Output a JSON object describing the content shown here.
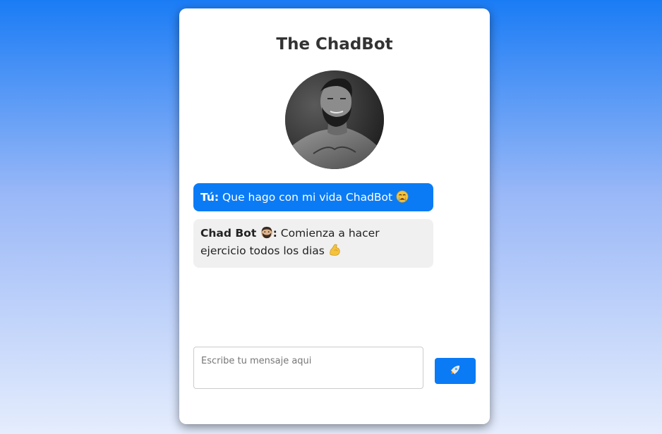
{
  "app": {
    "title": "The ChadBot"
  },
  "avatar": {
    "alt": "ChadBot avatar"
  },
  "messages": [
    {
      "role": "user",
      "sender": "Tú:",
      "text": "Que hago con mi vida ChadBot",
      "emoji": "crying-face"
    },
    {
      "role": "bot",
      "sender": "Chad Bot",
      "sender_emoji": "bearded-man",
      "sender_suffix": ":",
      "text": "Comienza a hacer ejercicio todos los dias",
      "emoji": "flexed-biceps"
    }
  ],
  "composer": {
    "placeholder": "Escribe tu mensaje aqui",
    "value": "",
    "send_icon": "rocket-icon"
  },
  "colors": {
    "accent": "#0a7bf5",
    "bot_bubble": "#f0f0f0",
    "title": "#333333"
  }
}
